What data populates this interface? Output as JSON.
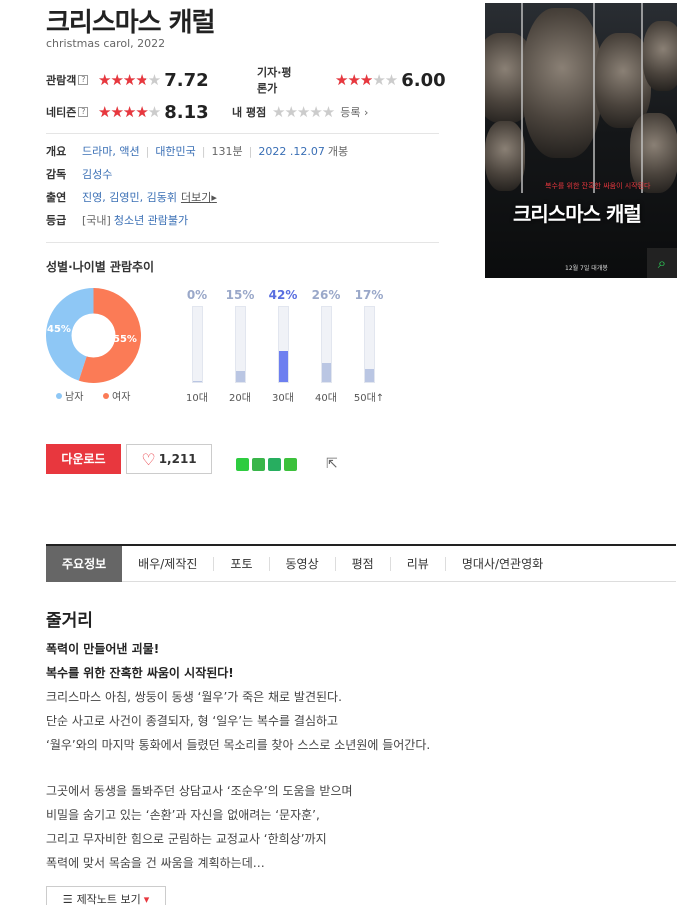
{
  "movie": {
    "title": "크리스마스 캐럴",
    "subtitle": "christmas carol, 2022"
  },
  "ratings": {
    "audience": {
      "label": "관람객",
      "score": "7.72",
      "stars": 7.72
    },
    "critic": {
      "label": "기자·평론가",
      "score": "6.00",
      "stars": 6.0
    },
    "netizen": {
      "label": "네티즌",
      "score": "8.13",
      "stars": 8.13
    },
    "mine": {
      "label": "내 평점",
      "register_label": "등록",
      "stars": 0
    },
    "help_mark": "?"
  },
  "info": {
    "overview_label": "개요",
    "genre": "드라마, 액션",
    "country": "대한민국",
    "runtime": "131분",
    "release_date": "2022 .12.07",
    "release_suffix": "개봉",
    "director_label": "감독",
    "director": "김성수",
    "cast_label": "출연",
    "cast": "진영, 김영민, 김동휘",
    "more_label": "더보기",
    "rating_label": "등급",
    "rating_prefix": "[국내]",
    "rating_value": "청소년 관람불가"
  },
  "poster": {
    "tagline": "복수를 위한 잔혹한 싸움이 시작된다",
    "title": "크리스마스 캐럴",
    "date": "12월 7일 대개봉",
    "zoom_icon": "search-icon"
  },
  "trend": {
    "title": "성별·나이별 관람추이",
    "male_label": "남자",
    "female_label": "여자",
    "male_pct": "45%",
    "female_pct": "55%",
    "male_color": "#8ec7f5",
    "female_color": "#fb7b56"
  },
  "chart_data": [
    {
      "type": "pie",
      "title": "성별",
      "categories": [
        "남자",
        "여자"
      ],
      "values": [
        45,
        55
      ],
      "colors": [
        "#8ec7f5",
        "#fb7b56"
      ]
    },
    {
      "type": "bar",
      "title": "나이별",
      "categories": [
        "10대",
        "20대",
        "30대",
        "40대",
        "50대↑"
      ],
      "values": [
        0,
        15,
        42,
        26,
        17
      ],
      "labels": [
        "0%",
        "15%",
        "42%",
        "26%",
        "17%"
      ],
      "ylim": [
        0,
        100
      ]
    }
  ],
  "actions": {
    "download_label": "다운로드",
    "like_count": "1,211"
  },
  "tabs": [
    "주요정보",
    "배우/제작진",
    "포토",
    "동영상",
    "평점",
    "리뷰",
    "명대사/연관영화"
  ],
  "plot": {
    "title": "줄거리",
    "headline1": "폭력이 만들어낸 괴물!",
    "headline2": "복수를 위한 잔혹한 싸움이 시작된다!",
    "line1": "크리스마스 아침, 쌍둥이 동생 ‘월우’가 죽은 채로 발견된다.",
    "line2": " 단순 사고로 사건이 종결되자, 형 ‘일우’는 복수를 결심하고",
    "line3": " ‘월우’와의 마지막 통화에서 들렸던 목소리를 찾아 스스로 소년원에 들어간다.",
    "line4": " 그곳에서 동생을 돌봐주던 상담교사 ‘조순우’의 도움을 받으며",
    "line5": " 비밀을 숨기고 있는 ‘손환’과 자신을 없애려는 ‘문자훈’,",
    "line6": " 그리고 무자비한 힘으로 군림하는 교정교사 ‘한희상’까지",
    "line7": " 폭력에 맞서 목숨을 건 싸움을 계획하는데…",
    "note_button": "제작노트 보기"
  }
}
